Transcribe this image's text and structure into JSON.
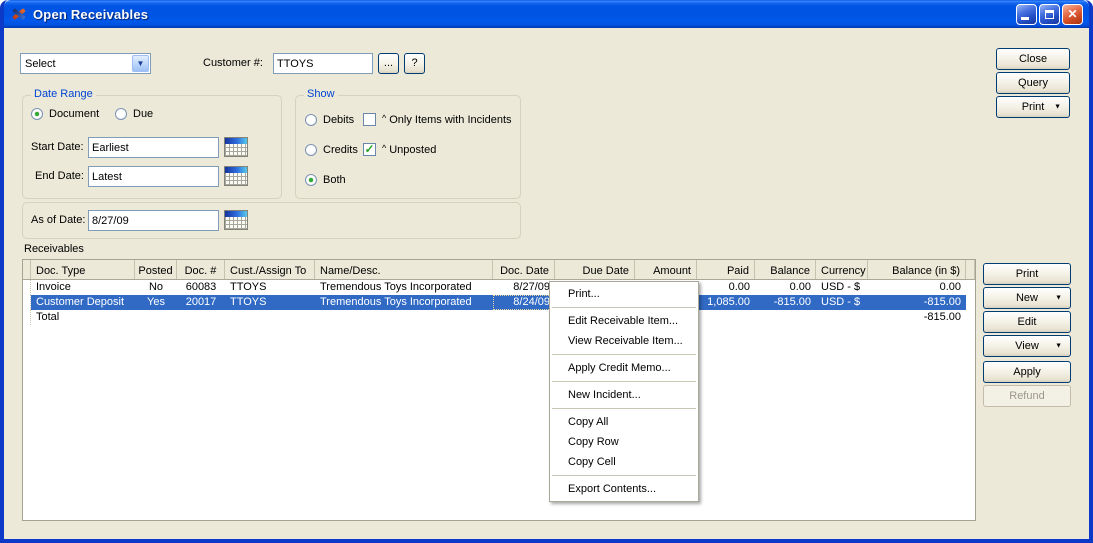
{
  "window": {
    "title": "Open Receivables"
  },
  "toolbar": {
    "select_value": "Select",
    "customer_label": "Customer #:",
    "customer_value": "TTOYS",
    "browse_button": "...",
    "help_button": "?"
  },
  "actions_top": {
    "close": "Close",
    "query": "Query",
    "print": "Print"
  },
  "date_range": {
    "title": "Date Range",
    "document_radio": "Document",
    "due_radio": "Due",
    "start_label": "Start Date:",
    "start_value": "Earliest",
    "end_label": "End Date:",
    "end_value": "Latest"
  },
  "show_group": {
    "title": "Show",
    "debits_radio": "Debits",
    "credits_radio": "Credits",
    "both_radio": "Both",
    "caret": "^",
    "incidents_checkbox": "Only Items with Incidents",
    "unposted_checkbox": "Unposted",
    "unposted_checkmark": "✓"
  },
  "as_of": {
    "label": "As of Date:",
    "value": "8/27/09"
  },
  "receivables": {
    "section_label": "Receivables",
    "columns": [
      "Doc. Type",
      "Posted",
      "Doc. #",
      "Cust./Assign To",
      "Name/Desc.",
      "Doc. Date",
      "Due Date",
      "Amount",
      "Paid",
      "Balance",
      "Currency",
      "Balance (in $)"
    ],
    "rows": [
      {
        "cells": [
          "Invoice",
          "No",
          "60083",
          "TTOYS",
          "Tremendous Toys Incorporated",
          "8/27/09",
          "",
          "",
          "0.00",
          "0.00",
          "USD - $",
          "0.00"
        ],
        "selected": false
      },
      {
        "cells": [
          "Customer Deposit",
          "Yes",
          "20017",
          "TTOYS",
          "Tremendous Toys Incorporated",
          "8/24/09",
          "",
          "",
          "1,085.00",
          "-815.00",
          "USD - $",
          "-815.00"
        ],
        "selected": true
      },
      {
        "cells": [
          "Total",
          "",
          "",
          "",
          "",
          "",
          "",
          "",
          "",
          "",
          "",
          "-815.00"
        ],
        "selected": false
      }
    ]
  },
  "context_menu": {
    "items": [
      "Print...",
      "Edit Receivable Item...",
      "View Receivable Item...",
      "Apply Credit Memo...",
      "New Incident...",
      "Copy All",
      "Copy Row",
      "Copy Cell",
      "Export Contents..."
    ]
  },
  "side_buttons": {
    "print": "Print",
    "new": "New",
    "edit": "Edit",
    "view": "View",
    "apply": "Apply",
    "refund": "Refund"
  },
  "colors": {
    "selection": "#316ac5",
    "titlebar": "#0054e3",
    "client_bg": "#ece9d8",
    "group_label": "#0046d5",
    "close_button": "#d6512a"
  }
}
